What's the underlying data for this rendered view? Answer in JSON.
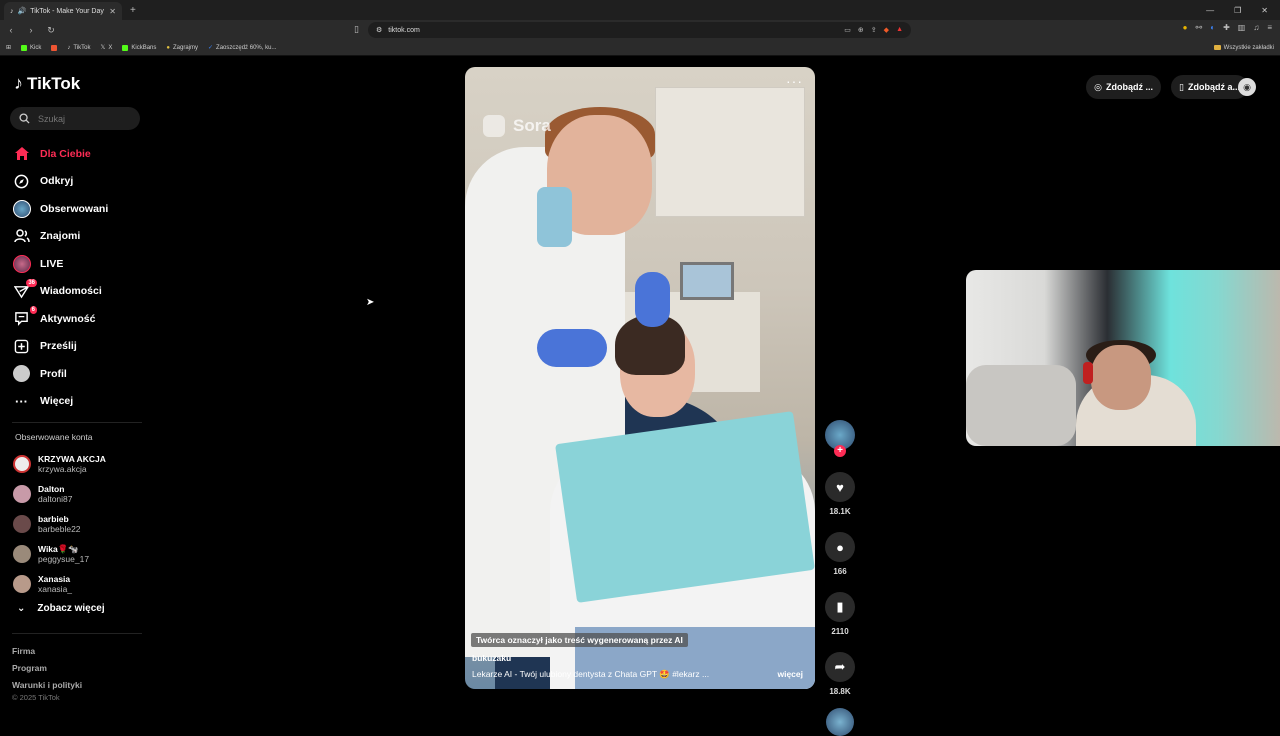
{
  "browser": {
    "tab_title": "TikTok - Make Your Day",
    "tab_close": "✕",
    "new_tab": "+",
    "url": "tiktok.com",
    "bookmarks": [
      "Kick",
      "TikTok",
      "X",
      "KickBans",
      "Zagrajmy",
      "Zaoszczędź 60%, ku..."
    ],
    "bookmarks_right": "Wszystkie zakładki"
  },
  "sidebar": {
    "logo": "TikTok",
    "search_placeholder": "Szukaj",
    "nav": [
      {
        "label": "Dla Ciebie",
        "icon": "home-icon",
        "active": true
      },
      {
        "label": "Odkryj",
        "icon": "compass-icon"
      },
      {
        "label": "Obserwowani",
        "icon": "following-avatar-icon"
      },
      {
        "label": "Znajomi",
        "icon": "friends-icon"
      },
      {
        "label": "LIVE",
        "icon": "live-icon"
      },
      {
        "label": "Wiadomości",
        "icon": "messages-icon",
        "badge": "36"
      },
      {
        "label": "Aktywność",
        "icon": "activity-icon",
        "badge": "6"
      },
      {
        "label": "Prześlij",
        "icon": "upload-icon"
      },
      {
        "label": "Profil",
        "icon": "profile-icon"
      },
      {
        "label": "Więcej",
        "icon": "more-icon"
      }
    ],
    "following_title": "Obserwowane konta",
    "accounts": [
      {
        "name": "KRZYWA AKCJA",
        "handle": "krzywa.akcja"
      },
      {
        "name": "Dalton",
        "handle": "daltoni87"
      },
      {
        "name": "barbieb",
        "handle": "barbeble22"
      },
      {
        "name": "Wika🌹🐄",
        "handle": "peggysue_17"
      },
      {
        "name": "Xanasia",
        "handle": "xanasia_"
      }
    ],
    "see_more": "Zobacz więcej",
    "footer": [
      "Firma",
      "Program",
      "Warunki i polityki"
    ],
    "copyright": "© 2025 TikTok"
  },
  "video": {
    "watermark": "Sora",
    "ai_label": "Twórca oznaczył jako treść wygenerowaną przez AI",
    "author": "bukuzaku",
    "description": "Lekarze AI - Twój ulubiony dentysta z Chata GPT 🤩  #lekarz  ...",
    "more": "więcej"
  },
  "actions": {
    "likes": "18.1K",
    "comments": "166",
    "saves": "2110",
    "shares": "18.8K"
  },
  "topbar": {
    "coins_label": "Zdobądź ...",
    "app_label": "Zdobądź a..."
  },
  "colors": {
    "accent": "#fe2c55",
    "bg": "#000000",
    "surface": "#1e1e1e"
  }
}
